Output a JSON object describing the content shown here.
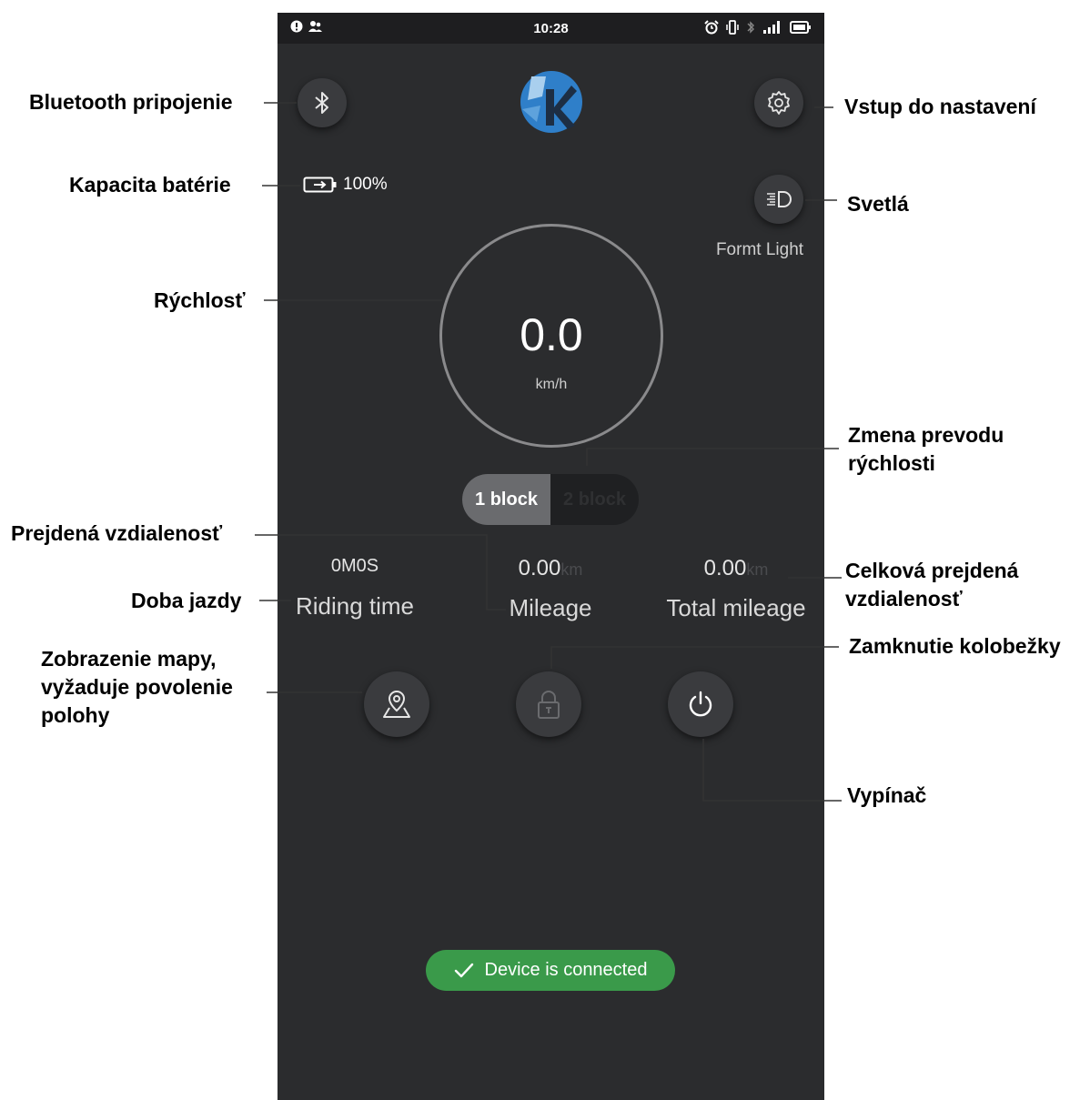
{
  "status_bar": {
    "time": "10:28"
  },
  "app": {
    "battery_percent": "100%",
    "light_label": "Formt Light",
    "speed": {
      "value": "0.0",
      "unit": "km/h"
    },
    "gears": [
      {
        "label": "1 block",
        "active": true
      },
      {
        "label": "2 block",
        "active": false
      }
    ],
    "stats": {
      "riding_time": {
        "value": "0M0S",
        "label": "Riding time"
      },
      "mileage": {
        "value": "0.00",
        "unit": "km",
        "label": "Mileage"
      },
      "total_mileage": {
        "value": "0.00",
        "unit": "km",
        "label": "Total mileage"
      }
    },
    "toast": "Device is connected"
  },
  "icons": {
    "bluetooth": "bluetooth-icon",
    "settings": "gear-icon",
    "headlight": "headlight-icon",
    "map": "map-pin-icon",
    "lock": "lock-icon",
    "power": "power-icon",
    "battery": "battery-icon",
    "check": "check-icon"
  },
  "colors": {
    "screen_bg": "#2b2c2e",
    "status_bar_bg": "#1e1e20",
    "button_bg": "#3a3b3e",
    "toast_bg": "#3a9a4a",
    "logo_blue": "#2f7fc9"
  },
  "annotations": {
    "bluetooth": "Bluetooth pripojenie",
    "battery": "Kapacita batérie",
    "speed": "Rýchlosť",
    "settings": "Vstup do nastavení",
    "lights": "Svetlá",
    "gear_1": "Zmena prevodu",
    "gear_2": "rýchlosti",
    "distance": "Prejdená vzdialenosť",
    "riding_time": "Doba jazdy",
    "total_1": "Celková prejdená",
    "total_2": "vzdialenosť",
    "lock": "Zamknutie kolobežky",
    "map_1": "Zobrazenie mapy,",
    "map_2": "vyžaduje povolenie",
    "map_3": "polohy",
    "power": "Vypínač"
  }
}
